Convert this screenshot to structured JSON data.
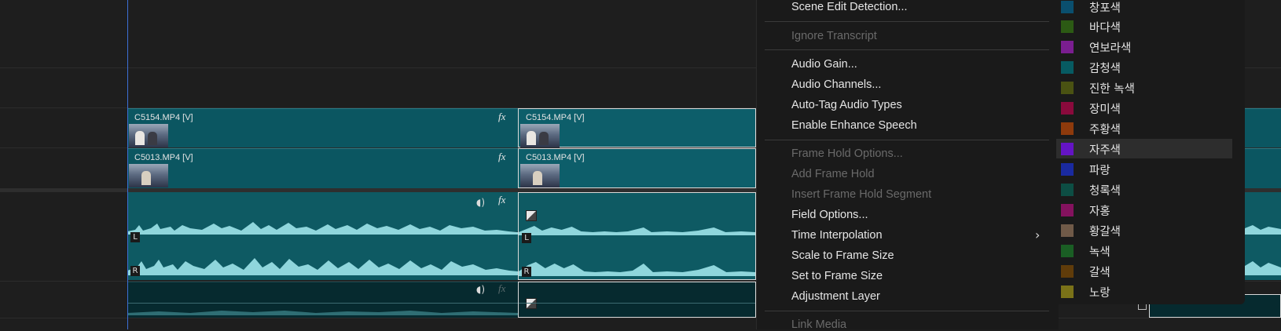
{
  "timeline": {
    "video_clips": [
      {
        "name": "C5154.MP4 [V]"
      },
      {
        "name": "C5154.MP4 [V]"
      },
      {
        "name": "C5013.MP4 [V]"
      },
      {
        "name": "C5013.MP4 [V]"
      }
    ],
    "channel_left": "L",
    "channel_right": "R",
    "fx_label": "fx"
  },
  "context_menu": {
    "items": [
      {
        "label": "Scene Edit Detection...",
        "enabled": true
      },
      {
        "label": "Ignore Transcript",
        "enabled": false
      },
      {
        "label": "Audio Gain...",
        "enabled": true
      },
      {
        "label": "Audio Channels...",
        "enabled": true
      },
      {
        "label": "Auto-Tag Audio Types",
        "enabled": true
      },
      {
        "label": "Enable Enhance Speech",
        "enabled": true
      },
      {
        "label": "Frame Hold Options...",
        "enabled": false
      },
      {
        "label": "Add Frame Hold",
        "enabled": false
      },
      {
        "label": "Insert Frame Hold Segment",
        "enabled": false
      },
      {
        "label": "Field Options...",
        "enabled": true
      },
      {
        "label": "Time Interpolation",
        "enabled": true,
        "submenu": true
      },
      {
        "label": "Scale to Frame Size",
        "enabled": true
      },
      {
        "label": "Set to Frame Size",
        "enabled": true
      },
      {
        "label": "Adjustment Layer",
        "enabled": true
      },
      {
        "label": "Link Media",
        "enabled": false
      }
    ],
    "submenu_arrow": "›"
  },
  "label_colors": {
    "highlighted": "자주색",
    "items": [
      {
        "label": "창포색",
        "color": "#0a4f6e"
      },
      {
        "label": "바다색",
        "color": "#2c5a14"
      },
      {
        "label": "연보라색",
        "color": "#7a1e90"
      },
      {
        "label": "감청색",
        "color": "#075b62"
      },
      {
        "label": "진한 녹색",
        "color": "#4a5212"
      },
      {
        "label": "장미색",
        "color": "#8a0a3c"
      },
      {
        "label": "주황색",
        "color": "#8e3a0c"
      },
      {
        "label": "자주색",
        "color": "#6414c4"
      },
      {
        "label": "파랑",
        "color": "#1a2aa0"
      },
      {
        "label": "청록색",
        "color": "#0d4e44"
      },
      {
        "label": "자홍",
        "color": "#84125e"
      },
      {
        "label": "황갈색",
        "color": "#705a48"
      },
      {
        "label": "녹색",
        "color": "#1a5e24"
      },
      {
        "label": "갈색",
        "color": "#603c0a"
      },
      {
        "label": "노랑",
        "color": "#7a7218"
      }
    ]
  }
}
